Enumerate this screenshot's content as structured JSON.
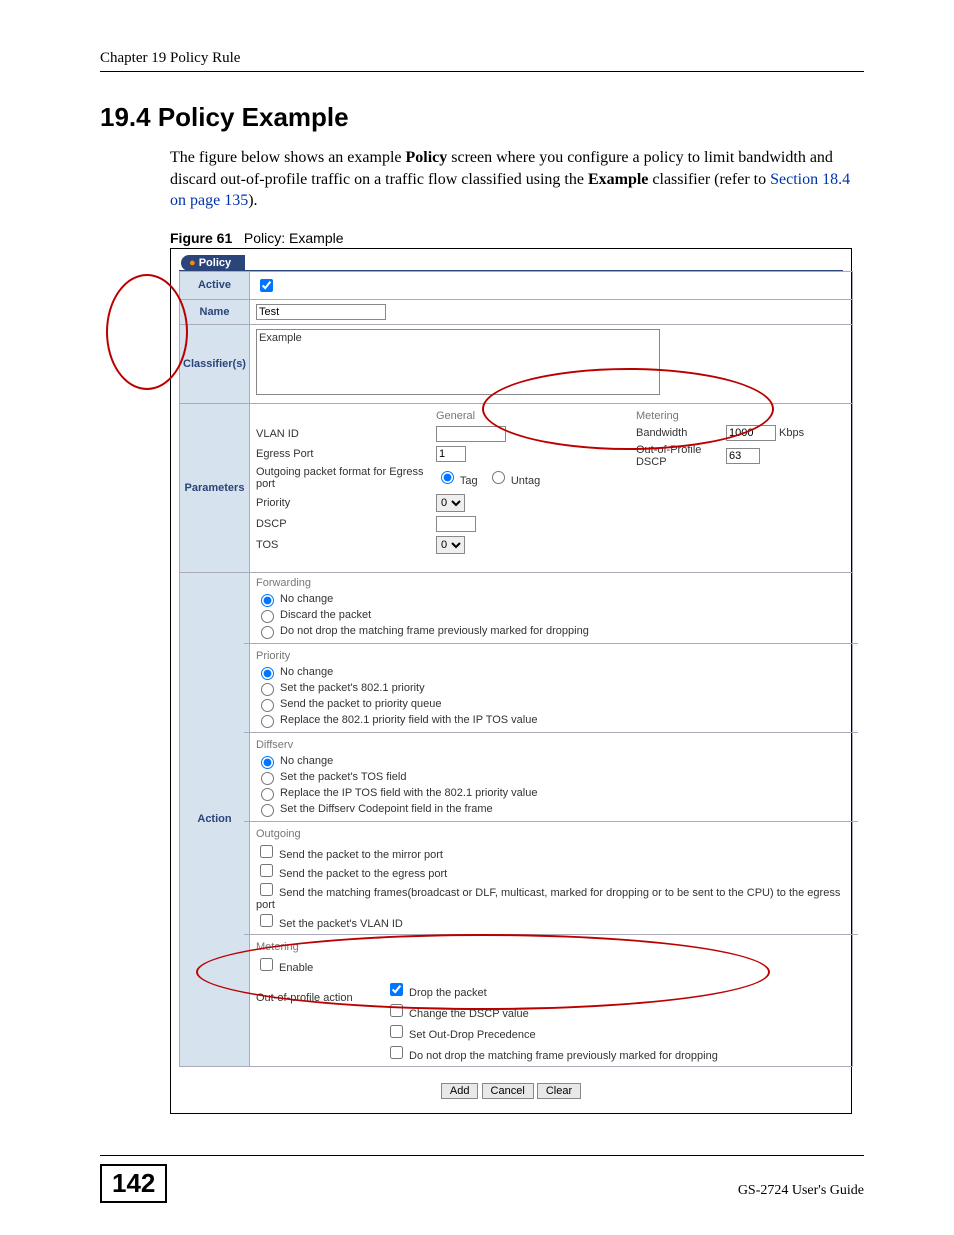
{
  "page": {
    "running_head": "Chapter 19 Policy Rule",
    "section_title": "19.4  Policy Example",
    "body_pre": "The figure below shows an example ",
    "body_bold1": "Policy",
    "body_mid": " screen where you configure a policy to limit bandwidth and discard out-of-profile traffic on a traffic flow classified using the ",
    "body_bold2": "Example",
    "body_post1": " classifier (refer to ",
    "body_link": "Section 18.4 on page 135",
    "body_post2": ").",
    "fig_label": "Figure 61",
    "fig_caption": "Policy: Example",
    "page_number": "142",
    "guide": "GS-2724 User's Guide"
  },
  "policy": {
    "tab": "Policy",
    "labels": {
      "active": "Active",
      "name": "Name",
      "classifiers": "Classifier(s)",
      "parameters": "Parameters",
      "action": "Action"
    },
    "active_checked": true,
    "name_value": "Test",
    "classifier_item": "Example",
    "general": {
      "header": "General",
      "vlan_id": "VLAN ID",
      "vlan_id_val": "",
      "egress_port": "Egress Port",
      "egress_port_val": "1",
      "egress_format": "Outgoing packet format for Egress port",
      "tag": "Tag",
      "untag": "Untag",
      "priority": "Priority",
      "priority_val": "0",
      "dscp": "DSCP",
      "dscp_val": "",
      "tos": "TOS",
      "tos_val": "0"
    },
    "metering": {
      "header": "Metering",
      "bandwidth": "Bandwidth",
      "bandwidth_val": "1000",
      "bandwidth_unit": "Kbps",
      "oop_dscp": "Out-of-Profile DSCP",
      "oop_dscp_val": "63"
    },
    "action": {
      "forwarding": {
        "header": "Forwarding",
        "no_change": "No change",
        "discard": "Discard the packet",
        "no_drop": "Do not drop the matching frame previously marked for dropping"
      },
      "priority": {
        "header": "Priority",
        "no_change": "No change",
        "set_8021p": "Set the packet's 802.1 priority",
        "send_queue": "Send the packet to priority queue",
        "replace_8021p": "Replace the 802.1 priority field with the IP TOS value"
      },
      "diffserv": {
        "header": "Diffserv",
        "no_change": "No change",
        "set_tos": "Set the packet's TOS field",
        "replace_tos": "Replace the IP TOS field with the 802.1 priority value",
        "set_dscp": "Set the Diffserv Codepoint field in the frame"
      },
      "outgoing": {
        "header": "Outgoing",
        "mirror": "Send the packet to the mirror port",
        "egress": "Send the packet to the egress port",
        "matching": "Send the matching frames(broadcast or DLF, multicast, marked for dropping or to be sent to the CPU) to the egress port",
        "set_vlan": "Set the packet's VLAN ID"
      },
      "metering": {
        "header": "Metering",
        "enable": "Enable",
        "oop_label": "Out-of-profile action",
        "drop": "Drop the packet",
        "change_dscp": "Change the DSCP value",
        "set_outdrop": "Set Out-Drop Precedence",
        "no_drop": "Do not drop the matching frame previously marked for dropping"
      }
    },
    "buttons": {
      "add": "Add",
      "cancel": "Cancel",
      "clear": "Clear"
    }
  }
}
